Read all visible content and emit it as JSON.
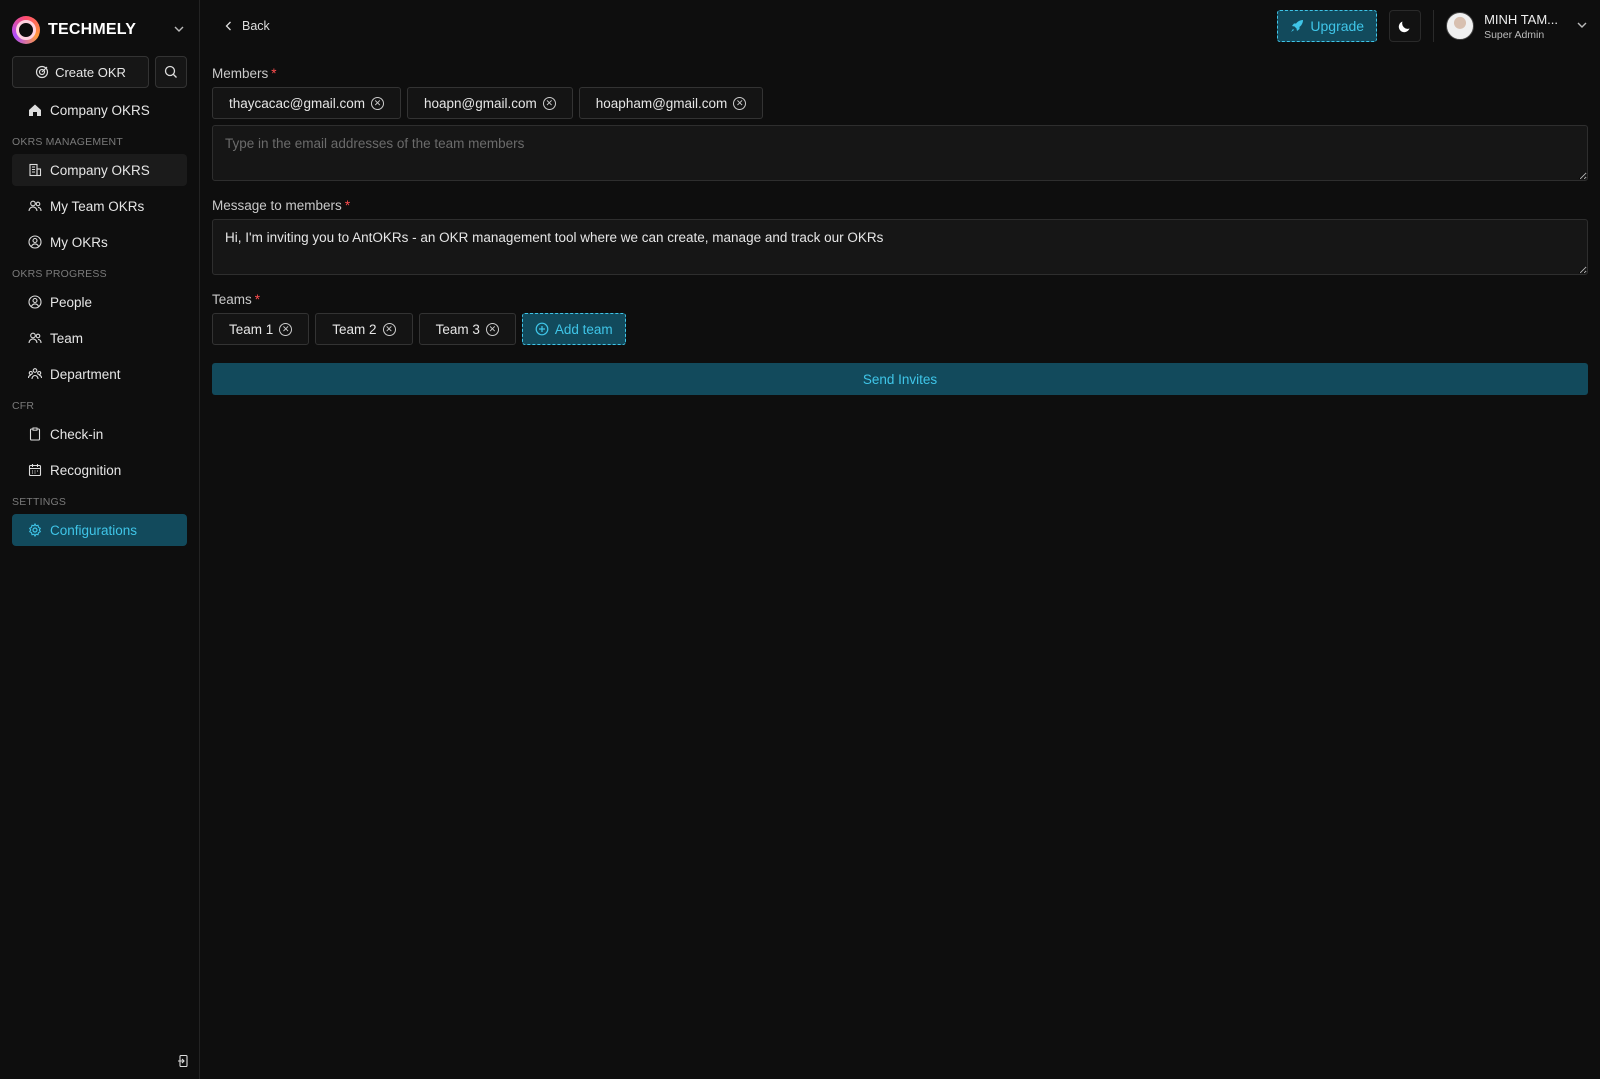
{
  "sidebar": {
    "brand": "TECHMELY",
    "create_label": "Create OKR",
    "home_item": "Company OKRS",
    "sections": [
      {
        "title": "OKRS MANAGEMENT",
        "items": [
          "Company OKRS",
          "My Team OKRs",
          "My OKRs"
        ]
      },
      {
        "title": "OKRS PROGRESS",
        "items": [
          "People",
          "Team",
          "Department"
        ]
      },
      {
        "title": "CFR",
        "items": [
          "Check-in",
          "Recognition"
        ]
      },
      {
        "title": "SETTINGS",
        "items": [
          "Configurations"
        ]
      }
    ]
  },
  "header": {
    "back_label": "Back",
    "upgrade_label": "Upgrade",
    "user_name": "MINH TAM...",
    "user_role": "Super Admin"
  },
  "form": {
    "members_label": "Members",
    "members": [
      "thaycacac@gmail.com",
      "hoapn@gmail.com",
      "hoapham@gmail.com"
    ],
    "email_placeholder": "Type in the email addresses of the team members",
    "message_label": "Message to members",
    "message_value": "Hi, I'm inviting you to AntOKRs - an OKR management tool where we can create, manage and track our OKRs",
    "teams_label": "Teams",
    "teams": [
      "Team 1",
      "Team 2",
      "Team 3"
    ],
    "add_team_label": "Add team",
    "send_label": "Send Invites"
  },
  "colors": {
    "accent": "#3fc5e8",
    "accent_bg": "#124a5c",
    "required": "#ff4d4f",
    "background": "#0e0e0e"
  }
}
